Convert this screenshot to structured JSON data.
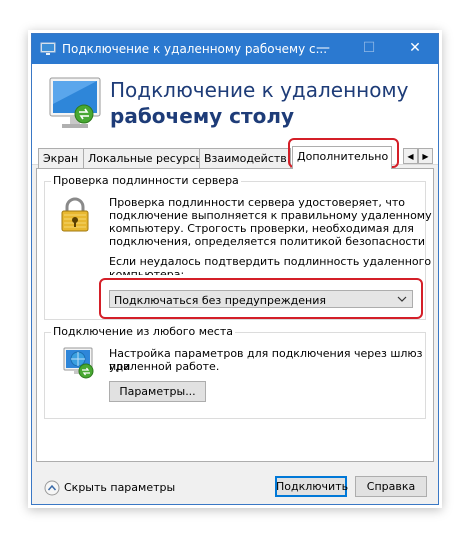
{
  "window": {
    "title": "Подключение к удаленному рабочему с...",
    "minimize": "—",
    "maximize": "☐",
    "close": "✕"
  },
  "header": {
    "line1": "Подключение к удаленному",
    "line2": "рабочему столу"
  },
  "tabs": [
    {
      "label": "Экран"
    },
    {
      "label": "Локальные ресурсы"
    },
    {
      "label": "Взаимодейств"
    },
    {
      "label": "Дополнительно"
    }
  ],
  "auth_group": {
    "title": "Проверка подлинности сервера",
    "description": [
      "Проверка подлинности сервера удостоверяет, что",
      "подключение выполняется к правильному удаленному",
      "компьютеру. Строгость проверки, необходимая для",
      "подключения, определяется политикой безопасности"
    ],
    "question": [
      "Если неудалось подтвердить подлинность удаленного",
      "компьютера:"
    ],
    "select_value": "Подключаться без предупреждения"
  },
  "anywhere_group": {
    "title": "Подключение из любого места",
    "description": [
      "Настройка параметров для подключения через шлюз при",
      "удаленной работе."
    ],
    "settings_button": "Параметры..."
  },
  "footer": {
    "hide_options": "Скрыть параметры",
    "connect_button": "Подключить",
    "help_button": "Справка"
  },
  "colors": {
    "titlebar": "#2b79d0",
    "header_text": "#1e3c78",
    "highlight": "#d41f28"
  }
}
